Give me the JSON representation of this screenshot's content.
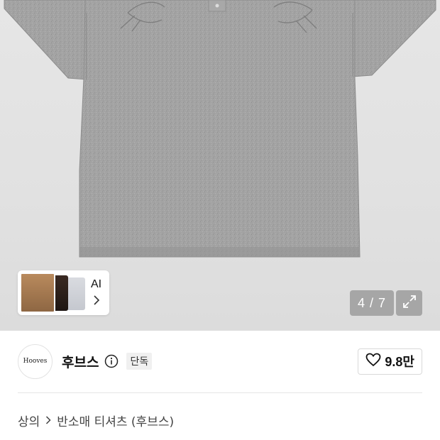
{
  "gallery": {
    "image_alt": "gray short sleeve t-shirt",
    "counter": "4 / 7",
    "ai_card": {
      "label": "AI"
    }
  },
  "brand": {
    "logo_text": "Hooves",
    "name": "후브스",
    "badge": "단독",
    "like_count": "9.8만"
  },
  "breadcrumb": {
    "items": [
      "상의",
      "반소매 티셔츠 (후브스)"
    ]
  },
  "colors": {
    "accent": "#111111",
    "shirt": "#9e9e9e",
    "background": "#e2e2e2"
  }
}
